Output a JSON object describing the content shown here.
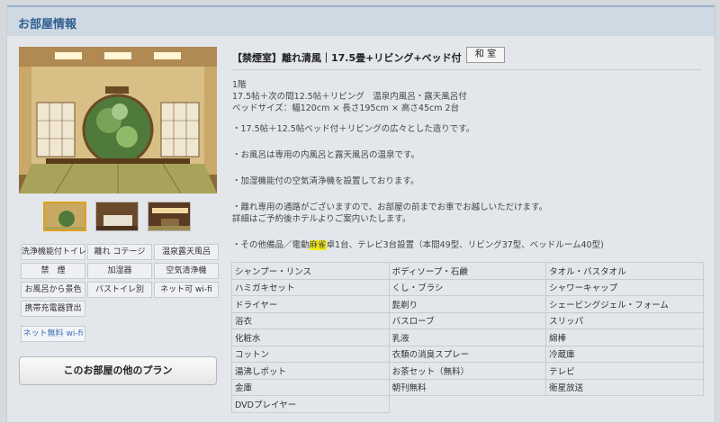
{
  "header": {
    "title": "お部屋情報"
  },
  "room": {
    "title": "【禁煙室】離れ清風｜17.5畳+リビング+ベッド付",
    "type_badge": "和 室",
    "floor": "1階",
    "layout": "17.5帖＋次の間12.5帖＋リビング　温泉内風呂・露天風呂付",
    "bed_size": "ベッドサイズ：幅120cm × 長さ195cm × 高さ45cm 2台",
    "features": [
      "・17.5帖＋12.5帖ベッド付＋リビングの広々とした造りです。",
      "・お風呂は専用の内風呂と露天風呂の温泉です。",
      "・加湿機能付の空気清浄機を設置しております。",
      "・離れ専用の通路がございますので、お部屋の前までお車でお越しいただけます。",
      "詳細はご予約後ホテルよりご案内いたします。"
    ],
    "other_prefix": "・その他備品／電動",
    "other_highlight": "麻雀",
    "other_suffix": "卓1台、テレビ3台設置（本間49型、リビング37型、ベッドルーム40型)"
  },
  "tags": [
    "洗浄機能付トイレ",
    "離れ コテージ",
    "温泉露天風呂",
    "禁　煙",
    "加湿器",
    "空気清浄機",
    "お風呂から景色",
    "バストイレ別",
    "ネット可 wi-fi",
    "携帯充電器貸出",
    "ネット無料 wi-fi"
  ],
  "plan_button": "このお部屋の他のプラン",
  "amenities": [
    "シャンプー・リンス",
    "ボディソープ・石鹸",
    "タオル・バスタオル",
    "ハミガキセット",
    "くし・ブラシ",
    "シャワーキャップ",
    "ドライヤー",
    "髭剃り",
    "シェービングジェル・フォーム",
    "浴衣",
    "バスローブ",
    "スリッパ",
    "化粧水",
    "乳液",
    "綿棒",
    "コットン",
    "衣類の消臭スプレー",
    "冷蔵庫",
    "湯沸しポット",
    "お茶セット（無料）",
    "テレビ",
    "金庫",
    "朝刊無料",
    "衛星放送",
    "DVDプレイヤー"
  ]
}
